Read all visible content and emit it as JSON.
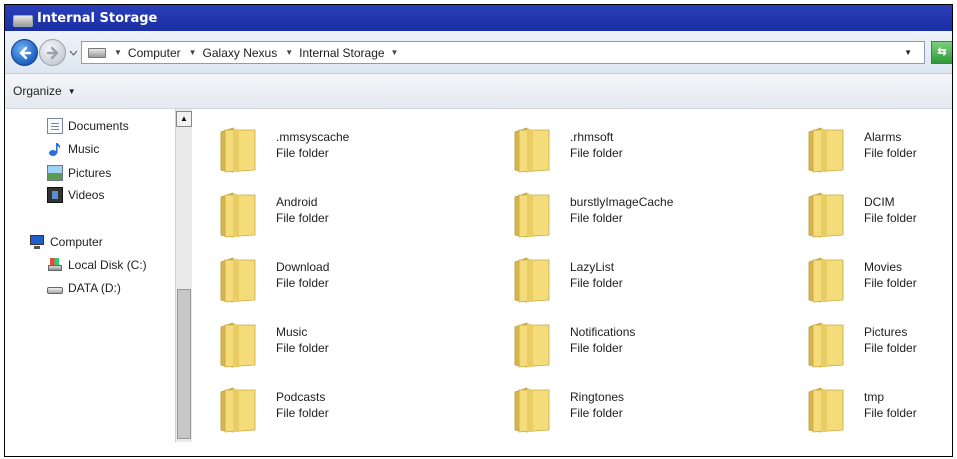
{
  "window": {
    "title": "Internal Storage"
  },
  "address": {
    "crumbs": [
      "Computer",
      "Galaxy Nexus",
      "Internal Storage"
    ]
  },
  "toolbar": {
    "organize_label": "Organize"
  },
  "sidebar": {
    "items": [
      {
        "label": "Documents",
        "icon": "documents-icon"
      },
      {
        "label": "Music",
        "icon": "music-note-icon"
      },
      {
        "label": "Pictures",
        "icon": "pictures-icon"
      },
      {
        "label": "Videos",
        "icon": "videos-icon"
      },
      {
        "label": "Computer",
        "icon": "computer-icon"
      },
      {
        "label": "Local Disk (C:)",
        "icon": "local-disk-icon"
      },
      {
        "label": "DATA (D:)",
        "icon": "drive-icon"
      }
    ]
  },
  "folders": [
    {
      "name": ".mmsyscache",
      "type": "File folder"
    },
    {
      "name": ".rhmsoft",
      "type": "File folder"
    },
    {
      "name": "Alarms",
      "type": "File folder"
    },
    {
      "name": "Android",
      "type": "File folder"
    },
    {
      "name": "burstlyImageCache",
      "type": "File folder"
    },
    {
      "name": "DCIM",
      "type": "File folder"
    },
    {
      "name": "Download",
      "type": "File folder"
    },
    {
      "name": "LazyList",
      "type": "File folder"
    },
    {
      "name": "Movies",
      "type": "File folder"
    },
    {
      "name": "Music",
      "type": "File folder"
    },
    {
      "name": "Notifications",
      "type": "File folder"
    },
    {
      "name": "Pictures",
      "type": "File folder"
    },
    {
      "name": "Podcasts",
      "type": "File folder"
    },
    {
      "name": "Ringtones",
      "type": "File folder"
    },
    {
      "name": "tmp",
      "type": "File folder"
    }
  ],
  "colors": {
    "titlebar": "#1f35ad",
    "folder": "#f2d46c",
    "accent": "#1c5fbf"
  }
}
